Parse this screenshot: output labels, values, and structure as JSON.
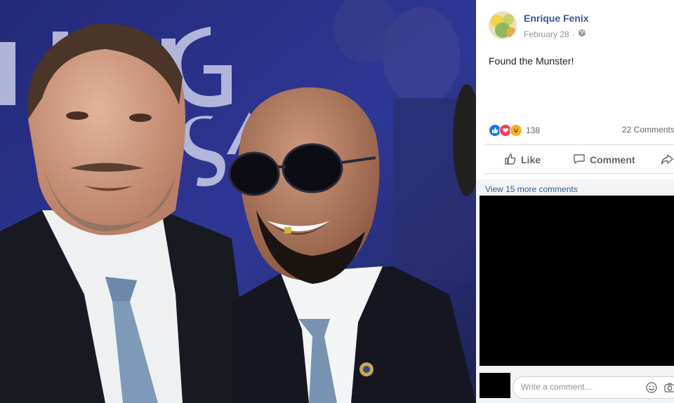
{
  "post": {
    "author": "Enrique Fenix",
    "date": "February 28",
    "separator": "·",
    "privacy_icon": "globe-icon",
    "text": "Found the Munster!"
  },
  "reactions": {
    "icons": [
      "like-reaction-icon",
      "love-reaction-icon",
      "haha-reaction-icon"
    ],
    "count": "138",
    "comments_count": "22 Comments"
  },
  "actions": {
    "like": "Like",
    "comment": "Comment"
  },
  "comments": {
    "view_more": "View 15 more comments",
    "placeholder": "Write a comment..."
  },
  "colors": {
    "link": "#385898",
    "like_blue": "#1877f2",
    "love_red": "#f33e58",
    "haha_yellow": "#f7b125",
    "backdrop_blue": "#2b2e7a"
  }
}
